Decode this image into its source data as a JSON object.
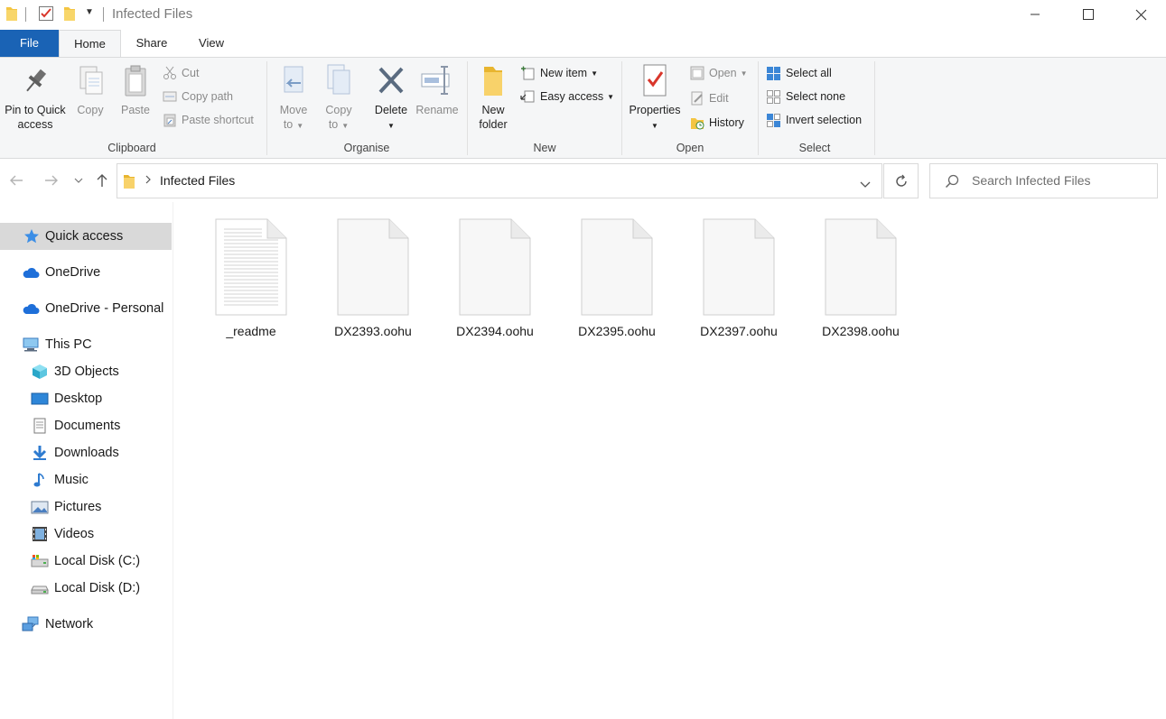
{
  "window": {
    "title": "Infected Files"
  },
  "ribbon_tabs": {
    "file": "File",
    "home": "Home",
    "share": "Share",
    "view": "View"
  },
  "clipboard": {
    "pin_line1": "Pin to Quick",
    "pin_line2": "access",
    "copy": "Copy",
    "paste": "Paste",
    "cut": "Cut",
    "copy_path": "Copy path",
    "paste_shortcut": "Paste shortcut",
    "label": "Clipboard"
  },
  "organise": {
    "move_line1": "Move",
    "move_line2": "to",
    "copyto_line1": "Copy",
    "copyto_line2": "to",
    "delete": "Delete",
    "rename": "Rename",
    "label": "Organise"
  },
  "new_group": {
    "new_folder_line1": "New",
    "new_folder_line2": "folder",
    "new_item": "New item",
    "easy_access": "Easy access",
    "label": "New"
  },
  "open_group": {
    "properties": "Properties",
    "open": "Open",
    "edit": "Edit",
    "history": "History",
    "label": "Open"
  },
  "select_group": {
    "select_all": "Select all",
    "select_none": "Select none",
    "invert_selection": "Invert selection",
    "label": "Select"
  },
  "address": {
    "path": "Infected Files"
  },
  "search": {
    "placeholder": "Search Infected Files"
  },
  "sidebar": {
    "items": [
      {
        "label": "Quick access",
        "icon": "star-icon"
      },
      {
        "label": "OneDrive",
        "icon": "cloud-icon"
      },
      {
        "label": "OneDrive - Personal",
        "icon": "cloud-icon"
      },
      {
        "label": "This PC",
        "icon": "computer-icon"
      },
      {
        "label": "3D Objects",
        "icon": "cube-icon"
      },
      {
        "label": "Desktop",
        "icon": "desktop-icon"
      },
      {
        "label": "Documents",
        "icon": "document-icon"
      },
      {
        "label": "Downloads",
        "icon": "download-icon"
      },
      {
        "label": "Music",
        "icon": "music-icon"
      },
      {
        "label": "Pictures",
        "icon": "pictures-icon"
      },
      {
        "label": "Videos",
        "icon": "video-icon"
      },
      {
        "label": "Local Disk (C:)",
        "icon": "drive-icon"
      },
      {
        "label": "Local Disk (D:)",
        "icon": "drive-icon"
      },
      {
        "label": "Network",
        "icon": "network-icon"
      }
    ]
  },
  "files": [
    {
      "name": "_readme",
      "icon": "text-file-icon"
    },
    {
      "name": "DX2393.oohu",
      "icon": "blank-file-icon"
    },
    {
      "name": "DX2394.oohu",
      "icon": "blank-file-icon"
    },
    {
      "name": "DX2395.oohu",
      "icon": "blank-file-icon"
    },
    {
      "name": "DX2397.oohu",
      "icon": "blank-file-icon"
    },
    {
      "name": "DX2398.oohu",
      "icon": "blank-file-icon"
    }
  ],
  "colors": {
    "accent": "#1a63b5",
    "folder": "#f4c542",
    "selected_bg": "#d9d9d9"
  }
}
